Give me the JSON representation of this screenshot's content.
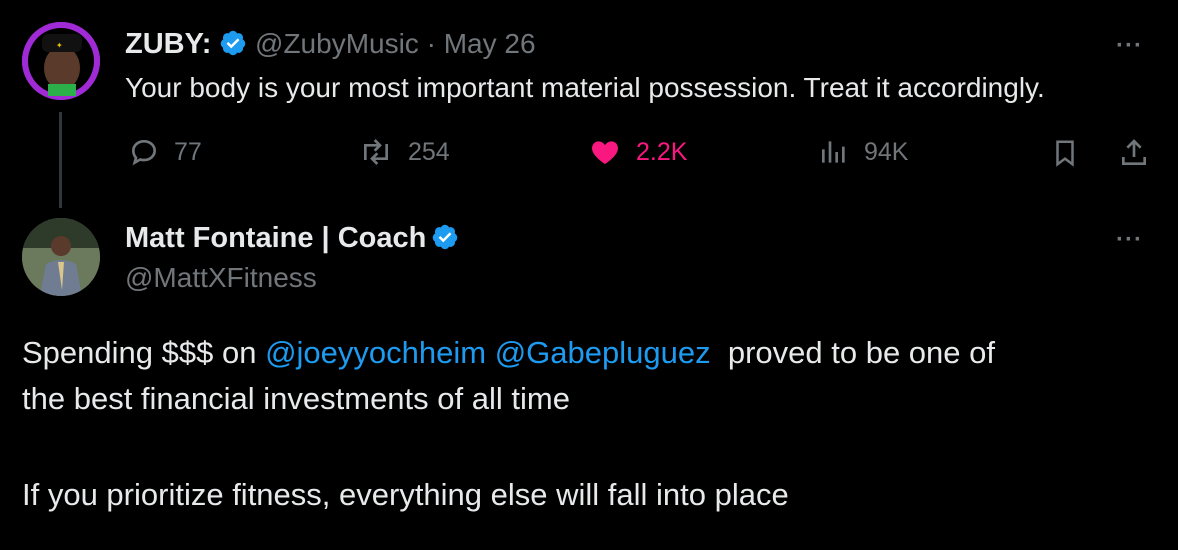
{
  "quoted_tweet": {
    "author_name": "ZUBY:",
    "handle": "@ZubyMusic",
    "separator": "·",
    "date": "May 26",
    "text": "Your body is your most important material possession. Treat it accordingly.",
    "replies": "77",
    "retweets": "254",
    "likes": "2.2K",
    "views": "94K",
    "like_color": "#f91880",
    "more_label": "···"
  },
  "reply_tweet": {
    "author_name": "Matt Fontaine | Coach",
    "handle": "@MattXFitness",
    "more_label": "···",
    "body": {
      "line1_prefix": "Spending $$$ on ",
      "mention1": "@joeyyochheim",
      "mention2": "@Gabepluguez",
      "line1_suffix": "  proved to be one of",
      "line2": "the best financial investments of all time",
      "line3": "If you prioritize fitness, everything else will fall into place"
    }
  },
  "colors": {
    "background": "#000000",
    "text": "#e7e9ea",
    "muted": "#71767b",
    "mention": "#1d9bf0",
    "verified": "#1d9bf0"
  }
}
